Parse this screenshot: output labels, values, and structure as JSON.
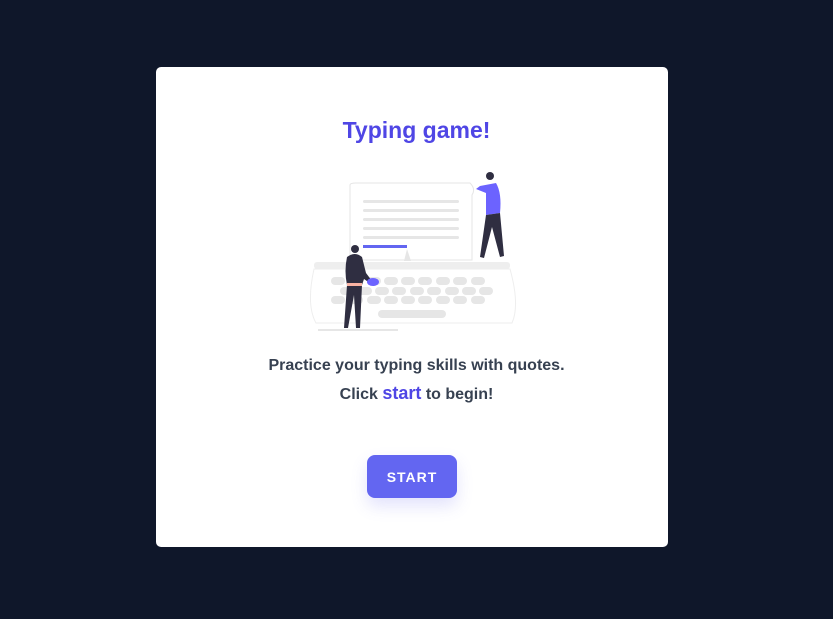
{
  "title": "Typing game!",
  "description": {
    "line1": "Practice your typing skills with quotes.",
    "line2_prefix": "Click",
    "line2_accent": "start",
    "line2_suffix": "to begin!"
  },
  "start_button": "START",
  "colors": {
    "background": "#0f172a",
    "accent": "#4f46e5",
    "button": "#6366f1",
    "text": "#374151"
  },
  "illustration": "typewriter-people-illustration"
}
